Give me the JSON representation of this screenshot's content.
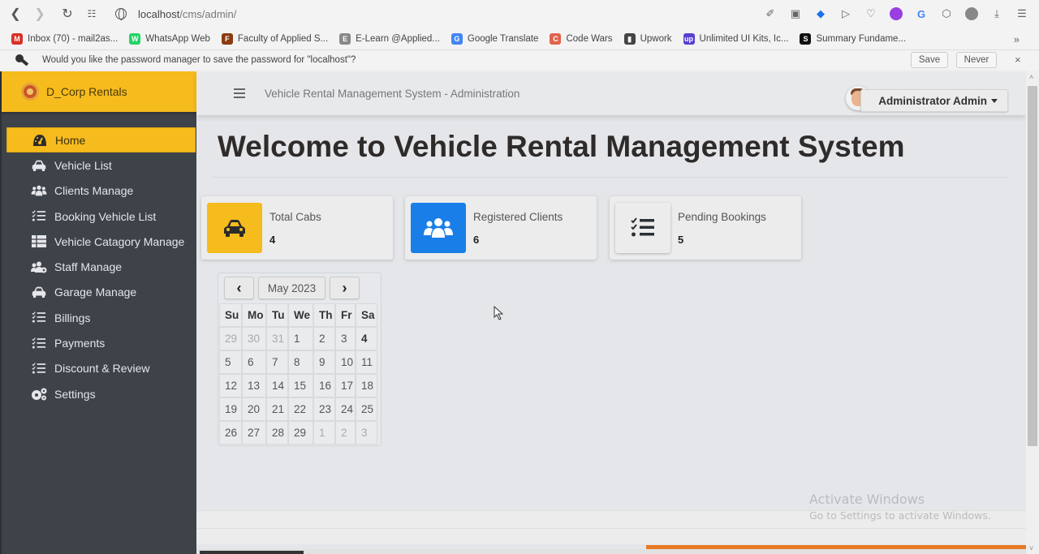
{
  "browser": {
    "url_host": "localhost",
    "url_path": "/cms/admin/",
    "bookmarks": [
      {
        "label": "Inbox (70) - mail2as...",
        "icon": "gmail-icon",
        "color": "#d93025",
        "glyph": "M"
      },
      {
        "label": "WhatsApp Web",
        "icon": "whatsapp-icon",
        "color": "#25d366",
        "glyph": "W"
      },
      {
        "label": "Faculty of Applied S...",
        "icon": "faculty-icon",
        "color": "#8a3b12",
        "glyph": "F"
      },
      {
        "label": "E-Learn @Applied...",
        "icon": "elearn-icon",
        "color": "#888888",
        "glyph": "E"
      },
      {
        "label": "Google Translate",
        "icon": "google-translate-icon",
        "color": "#4285f4",
        "glyph": "G"
      },
      {
        "label": "Code Wars",
        "icon": "codewars-icon",
        "color": "#e0634a",
        "glyph": "C"
      },
      {
        "label": "Upwork",
        "icon": "document-icon",
        "color": "#444444",
        "glyph": "▮"
      },
      {
        "label": "Unlimited UI Kits, Ic...",
        "icon": "ui-kits-icon",
        "color": "#5a3fd0",
        "glyph": "up"
      },
      {
        "label": "Summary Fundame...",
        "icon": "summary-icon",
        "color": "#111111",
        "glyph": "S"
      }
    ],
    "more_bookmarks": "»",
    "password_prompt": {
      "message": "Would you like the password manager to save the password for \"localhost\"?",
      "save_label": "Save",
      "never_label": "Never",
      "close_label": "×"
    }
  },
  "brand": {
    "name": "D_Corp Rentals",
    "color": "#f6bb1c"
  },
  "sidebar": {
    "items": [
      {
        "label": "Home",
        "icon": "dashboard-icon",
        "active": true
      },
      {
        "label": "Vehicle List",
        "icon": "car-icon"
      },
      {
        "label": "Clients Manage",
        "icon": "users-icon"
      },
      {
        "label": "Booking Vehicle List",
        "icon": "tasks-list-icon"
      },
      {
        "label": "Vehicle Catagory Manage",
        "icon": "table-icon"
      },
      {
        "label": "Staff Manage",
        "icon": "users-cog-icon"
      },
      {
        "label": "Garage Manage",
        "icon": "car-icon"
      },
      {
        "label": "Billings",
        "icon": "tasks-list-icon"
      },
      {
        "label": "Payments",
        "icon": "tasks-list-icon"
      },
      {
        "label": "Discount & Review",
        "icon": "tasks-list-icon"
      },
      {
        "label": "Settings",
        "icon": "cogs-icon"
      }
    ]
  },
  "header": {
    "title": "Vehicle Rental Management System - Administration",
    "user_label": "Administrator Admin"
  },
  "main": {
    "welcome": "Welcome to Vehicle Rental Management System",
    "cards": [
      {
        "label": "Total Cabs",
        "value": "4",
        "icon": "car-icon",
        "color": "#f6bb1c"
      },
      {
        "label": "Registered Clients",
        "value": "6",
        "icon": "users-icon",
        "color": "#1a7ee8"
      },
      {
        "label": "Pending Bookings",
        "value": "5",
        "icon": "tasks-list-icon",
        "color": "#ececec"
      }
    ],
    "calendar": {
      "prev_label": "‹",
      "next_label": "›",
      "month_label": "May 2023",
      "weekdays": [
        "Su",
        "Mo",
        "Tu",
        "We",
        "Th",
        "Fr",
        "Sa"
      ],
      "weeks": [
        [
          {
            "d": "29",
            "m": true
          },
          {
            "d": "30",
            "m": true
          },
          {
            "d": "31",
            "m": true
          },
          {
            "d": "1"
          },
          {
            "d": "2"
          },
          {
            "d": "3"
          },
          {
            "d": "4",
            "today": true
          }
        ],
        [
          {
            "d": "5"
          },
          {
            "d": "6"
          },
          {
            "d": "7"
          },
          {
            "d": "8"
          },
          {
            "d": "9"
          },
          {
            "d": "10"
          },
          {
            "d": "11"
          }
        ],
        [
          {
            "d": "12"
          },
          {
            "d": "13"
          },
          {
            "d": "14"
          },
          {
            "d": "15"
          },
          {
            "d": "16"
          },
          {
            "d": "17"
          },
          {
            "d": "18"
          }
        ],
        [
          {
            "d": "19"
          },
          {
            "d": "20"
          },
          {
            "d": "21"
          },
          {
            "d": "22"
          },
          {
            "d": "23"
          },
          {
            "d": "24"
          },
          {
            "d": "25"
          }
        ],
        [
          {
            "d": "26"
          },
          {
            "d": "27"
          },
          {
            "d": "28"
          },
          {
            "d": "29"
          },
          {
            "d": "1",
            "m": true
          },
          {
            "d": "2",
            "m": true
          },
          {
            "d": "3",
            "m": true
          }
        ]
      ]
    }
  },
  "watermark": {
    "line1": "Activate Windows",
    "line2": "Go to Settings to activate Windows."
  }
}
